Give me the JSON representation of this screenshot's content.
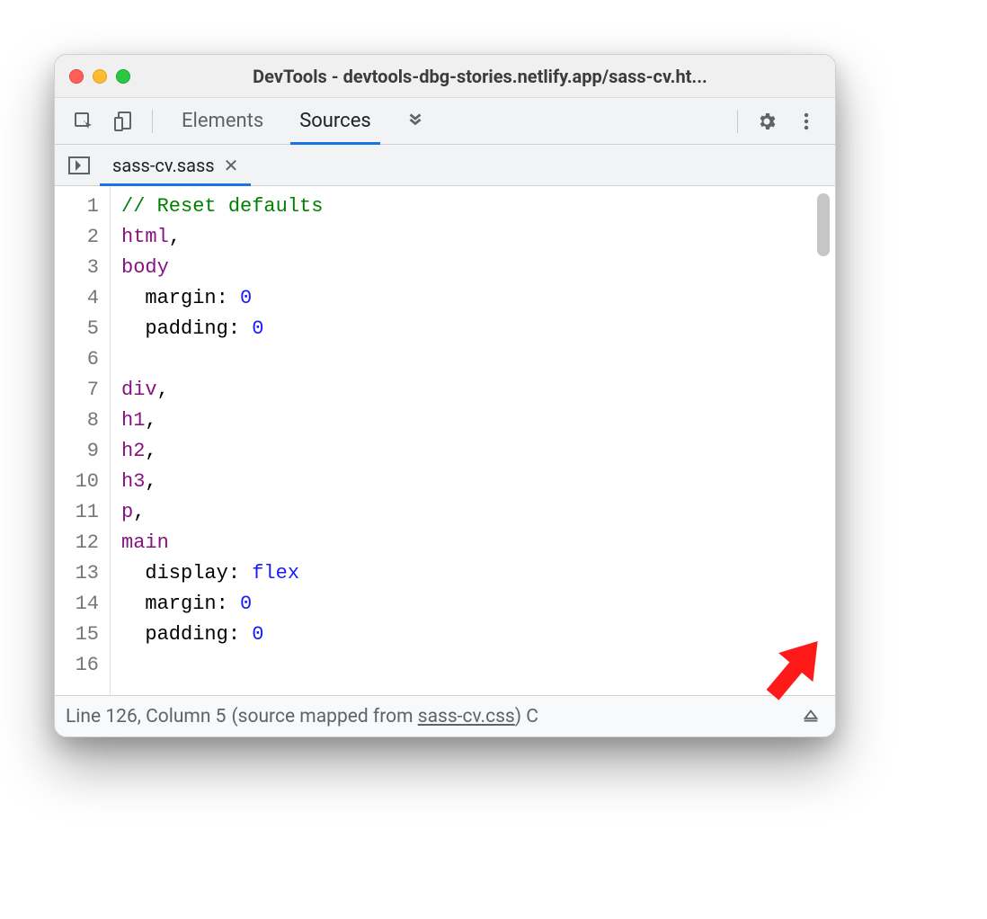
{
  "window": {
    "title": "DevTools - devtools-dbg-stories.netlify.app/sass-cv.ht..."
  },
  "toolbar": {
    "tabs": [
      {
        "label": "Elements",
        "active": false
      },
      {
        "label": "Sources",
        "active": true
      }
    ]
  },
  "filetab": {
    "name": "sass-cv.sass"
  },
  "code": {
    "lines": [
      {
        "n": 1,
        "tokens": [
          [
            "comment",
            "// Reset defaults"
          ]
        ]
      },
      {
        "n": 2,
        "tokens": [
          [
            "sel",
            "html"
          ],
          [
            "punc",
            ","
          ]
        ]
      },
      {
        "n": 3,
        "tokens": [
          [
            "sel",
            "body"
          ]
        ]
      },
      {
        "n": 4,
        "tokens": [
          [
            "plain",
            "  "
          ],
          [
            "prop",
            "margin"
          ],
          [
            "punc",
            ": "
          ],
          [
            "val",
            "0"
          ]
        ]
      },
      {
        "n": 5,
        "tokens": [
          [
            "plain",
            "  "
          ],
          [
            "prop",
            "padding"
          ],
          [
            "punc",
            ": "
          ],
          [
            "val",
            "0"
          ]
        ]
      },
      {
        "n": 6,
        "tokens": []
      },
      {
        "n": 7,
        "tokens": [
          [
            "sel",
            "div"
          ],
          [
            "punc",
            ","
          ]
        ]
      },
      {
        "n": 8,
        "tokens": [
          [
            "sel",
            "h1"
          ],
          [
            "punc",
            ","
          ]
        ]
      },
      {
        "n": 9,
        "tokens": [
          [
            "sel",
            "h2"
          ],
          [
            "punc",
            ","
          ]
        ]
      },
      {
        "n": 10,
        "tokens": [
          [
            "sel",
            "h3"
          ],
          [
            "punc",
            ","
          ]
        ]
      },
      {
        "n": 11,
        "tokens": [
          [
            "sel",
            "p"
          ],
          [
            "punc",
            ","
          ]
        ]
      },
      {
        "n": 12,
        "tokens": [
          [
            "sel",
            "main"
          ]
        ]
      },
      {
        "n": 13,
        "tokens": [
          [
            "plain",
            "  "
          ],
          [
            "prop",
            "display"
          ],
          [
            "punc",
            ": "
          ],
          [
            "val",
            "flex"
          ]
        ]
      },
      {
        "n": 14,
        "tokens": [
          [
            "plain",
            "  "
          ],
          [
            "prop",
            "margin"
          ],
          [
            "punc",
            ": "
          ],
          [
            "val",
            "0"
          ]
        ]
      },
      {
        "n": 15,
        "tokens": [
          [
            "plain",
            "  "
          ],
          [
            "prop",
            "padding"
          ],
          [
            "punc",
            ": "
          ],
          [
            "val",
            "0"
          ]
        ]
      },
      {
        "n": 16,
        "tokens": []
      }
    ]
  },
  "status": {
    "position": "Line 126, Column 5",
    "mapped_prefix": "(source mapped from ",
    "mapped_file": "sass-cv.css",
    "mapped_suffix": ")",
    "trail": " C"
  }
}
